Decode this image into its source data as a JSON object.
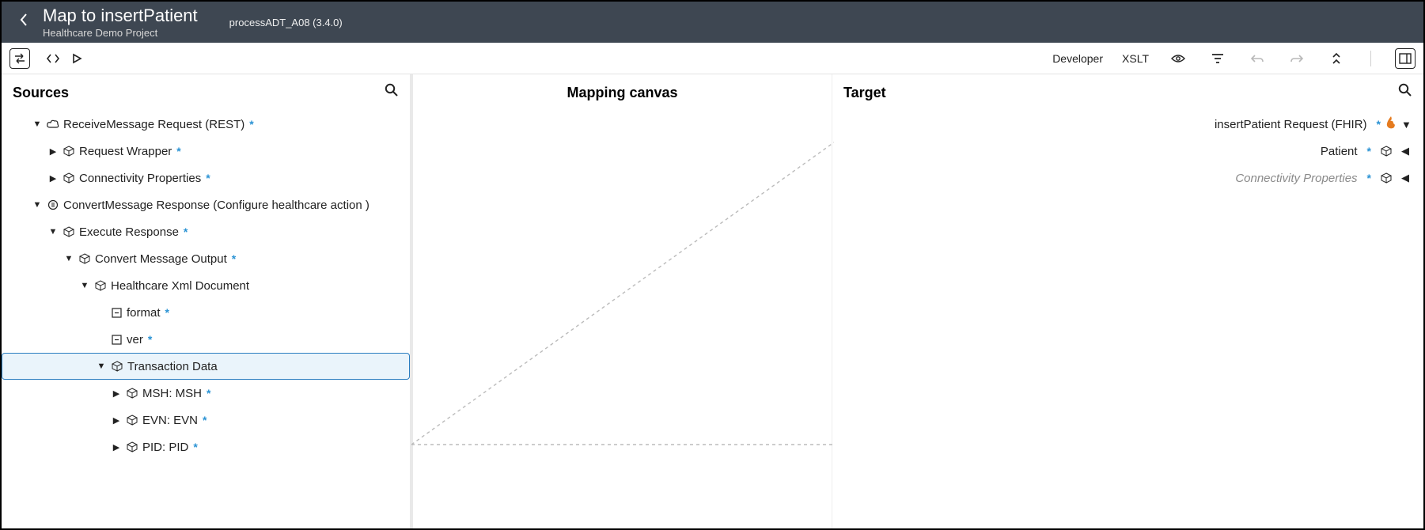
{
  "header": {
    "title": "Map to insertPatient",
    "subtitle": "Healthcare Demo Project",
    "context": "processADT_A08 (3.4.0)"
  },
  "toolbar": {
    "developer": "Developer",
    "xslt": "XSLT"
  },
  "sources": {
    "title": "Sources",
    "tree": {
      "receiveMessage": "ReceiveMessage Request (REST)",
      "requestWrapper": "Request Wrapper",
      "connectivityProps": "Connectivity Properties",
      "convertMessage": "ConvertMessage Response (Configure healthcare action )",
      "executeResponse": "Execute Response",
      "convertOutput": "Convert Message Output",
      "healthcareXml": "Healthcare Xml Document",
      "format": "format",
      "ver": "ver",
      "transactionData": "Transaction Data",
      "msh": "MSH: MSH",
      "evn": "EVN: EVN",
      "pid": "PID: PID"
    }
  },
  "canvas": {
    "title": "Mapping canvas"
  },
  "target": {
    "title": "Target",
    "tree": {
      "insertPatient": "insertPatient Request (FHIR)",
      "patient": "Patient",
      "connectivityProps": "Connectivity Properties"
    }
  }
}
